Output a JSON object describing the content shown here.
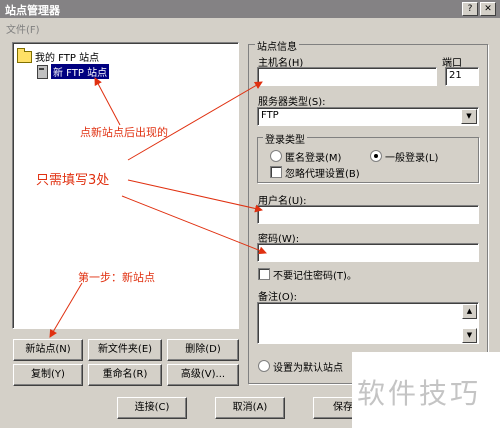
{
  "window": {
    "title": "站点管理器",
    "menu_file": "文件(F)"
  },
  "tree": {
    "root": "我的 FTP 站点",
    "child": "新 FTP 站点"
  },
  "left_buttons": {
    "new_site": "新站点(N)",
    "new_folder": "新文件夹(E)",
    "delete": "删除(D)",
    "copy": "复制(Y)",
    "rename": "重命名(R)",
    "advanced": "高级(V)..."
  },
  "site_info": {
    "group_label": "站点信息",
    "host_label": "主机名(H)",
    "host_value": "",
    "port_label": "端口",
    "port_value": "21",
    "server_type_label": "服务器类型(S):",
    "server_type_value": "FTP",
    "login_type_label": "登录类型",
    "anonymous_label": "匿名登录(M)",
    "normal_label": "一般登录(L)",
    "ignore_proxy_label": "忽略代理设置(B)",
    "username_label": "用户名(U):",
    "username_value": "",
    "password_label": "密码(W):",
    "password_value": "",
    "no_remember_label": "不要记住密码(T)。",
    "notes_label": "备注(O):",
    "default_site_label": "设置为默认站点"
  },
  "bottom_buttons": {
    "connect": "连接(C)",
    "cancel": "取消(A)",
    "save": "保存并"
  },
  "annotations": {
    "new_site_appears": "点新站点后出现的",
    "fill_three": "只需填写3处",
    "step_one": "第一步：新站点"
  },
  "watermark": "软件技巧",
  "colors": {
    "annotation": "#e03010",
    "selection": "#000080",
    "window": "#d4d0c8"
  }
}
